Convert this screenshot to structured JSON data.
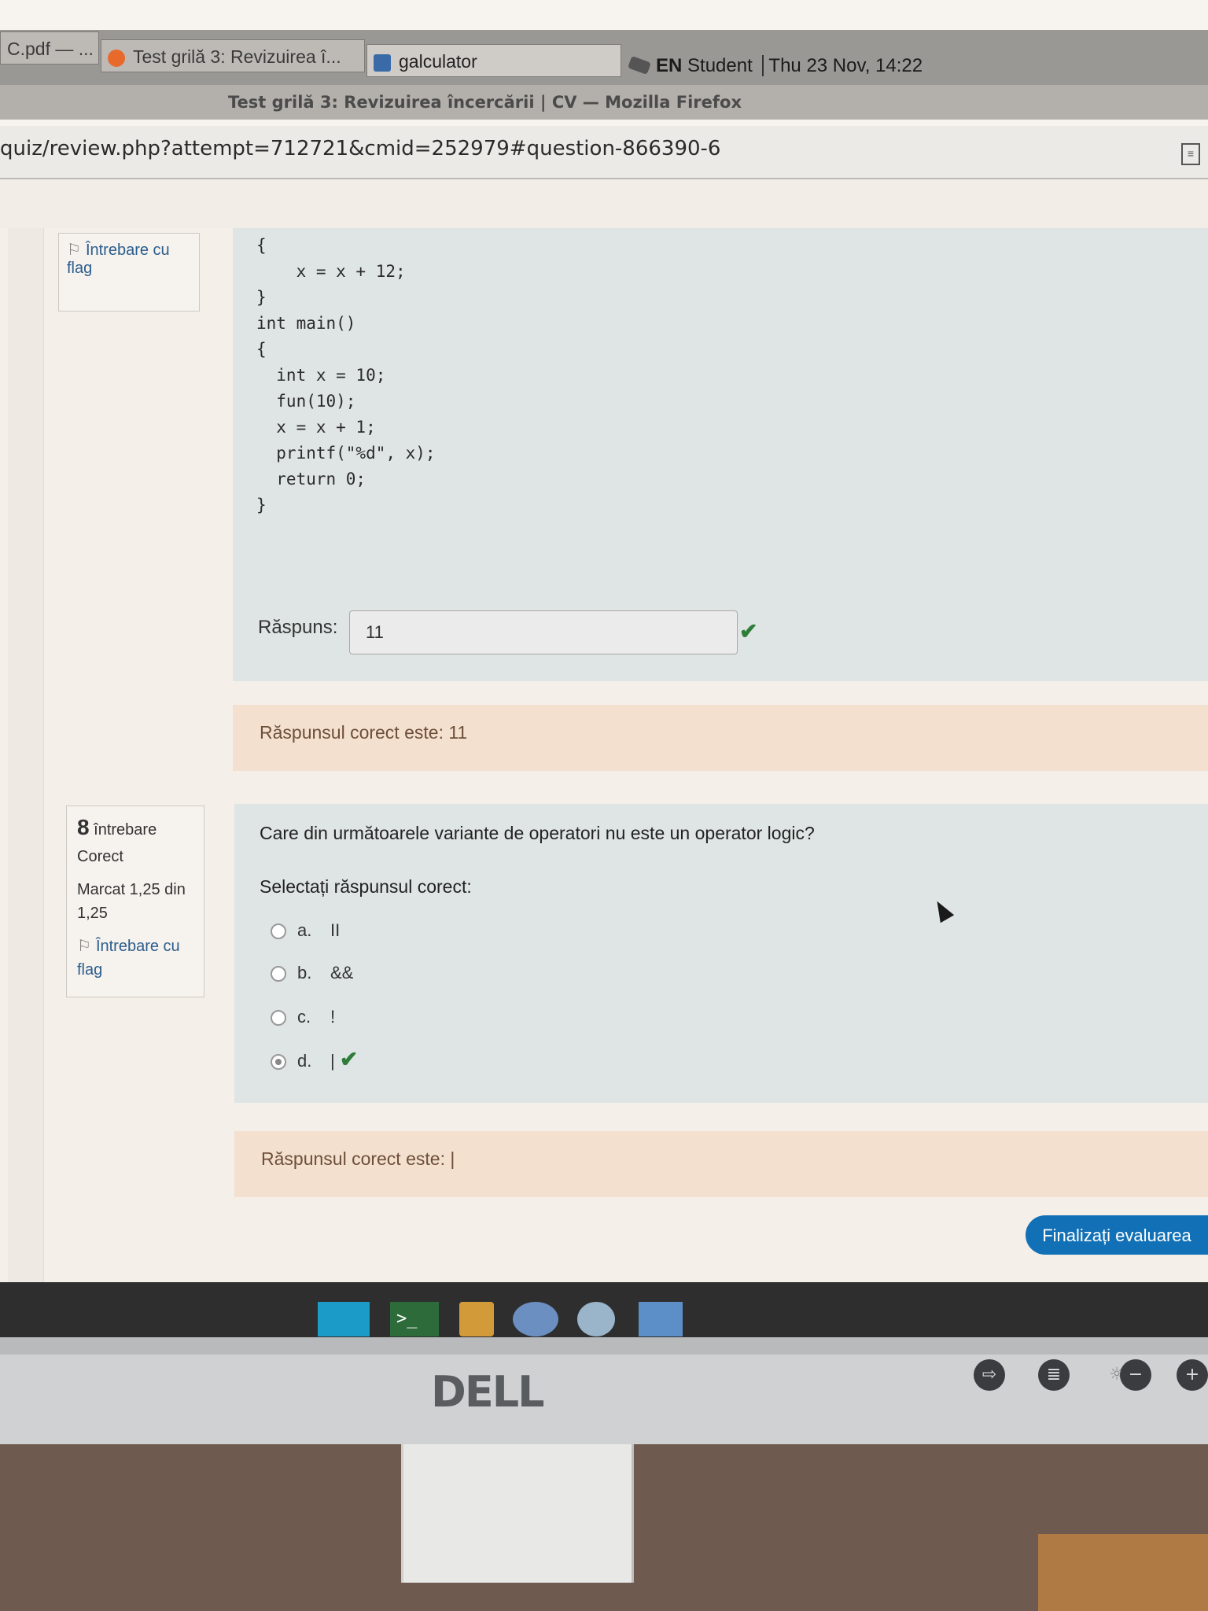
{
  "taskbar_top": {
    "items": [
      {
        "label": "C.pdf — ..."
      },
      {
        "label": "Test grilă 3: Revizuirea î..."
      },
      {
        "label": "galculator"
      }
    ],
    "keyboard": "EN",
    "user": "Student",
    "datetime": "Thu 23 Nov, 14:22"
  },
  "window": {
    "title": "Test grilă 3: Revizuirea încercării | CV — Mozilla Firefox",
    "url": "quiz/review.php?attempt=712721&cmid=252979#question-866390-6"
  },
  "question7": {
    "flag_label": "Întrebare cu flag",
    "code": "{\n    x = x + 12;\n}\nint main()\n{\n  int x = 10;\n  fun(10);\n  x = x + 1;\n  printf(\"%d\", x);\n  return 0;\n}",
    "answer_label": "Răspuns:",
    "answer_value": "11",
    "correct_feedback": "Răspunsul corect este: 11"
  },
  "question8": {
    "number": "8",
    "word": "întrebare",
    "state": "Corect",
    "grade": "Marcat 1,25 din 1,25",
    "flag_label": "Întrebare cu flag",
    "text": "Care din următoarele variante de operatori nu este un operator logic?",
    "prompt": "Selectați răspunsul corect:",
    "options": [
      {
        "letter": "a.",
        "text": "II",
        "selected": false
      },
      {
        "letter": "b.",
        "text": "&&",
        "selected": false
      },
      {
        "letter": "c.",
        "text": "!",
        "selected": false
      },
      {
        "letter": "d.",
        "text": "|",
        "selected": true
      }
    ],
    "correct_feedback": "Răspunsul corect este: |"
  },
  "finish_button": "Finalizați evaluarea",
  "monitor_brand": "DELL",
  "colors": {
    "accent": "#1271b6",
    "correct": "#2f7d3a",
    "feedback_bg": "#f3e0cf"
  }
}
